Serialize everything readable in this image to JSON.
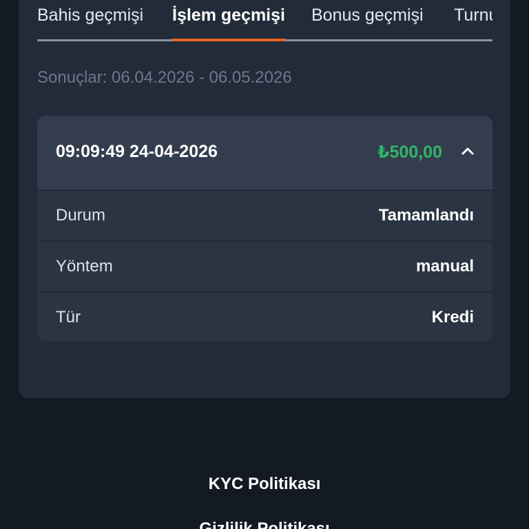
{
  "tabs": [
    {
      "label": "Bahis geçmişi",
      "active": false
    },
    {
      "label": "İşlem geçmişi",
      "active": true
    },
    {
      "label": "Bonus geçmişi",
      "active": false
    },
    {
      "label": "Turnuva",
      "active": false
    }
  ],
  "results_label": "Sonuçlar: 06.04.2026 - 06.05.2026",
  "transaction": {
    "datetime": "09:09:49 24-04-2026",
    "amount": "₺500,00",
    "rows": [
      {
        "label": "Durum",
        "value": "Tamamlandı"
      },
      {
        "label": "Yöntem",
        "value": "manual"
      },
      {
        "label": "Tür",
        "value": "Kredi"
      }
    ]
  },
  "footer": {
    "links": [
      "KYC Politikası",
      "Gizlilik Politikası"
    ]
  },
  "colors": {
    "accent": "#e8641f",
    "amount_positive": "#2fb569",
    "background": "#141a24",
    "panel": "#222b39",
    "card": "#343d4d"
  },
  "icons": {
    "collapse": "chevron-up-icon"
  }
}
